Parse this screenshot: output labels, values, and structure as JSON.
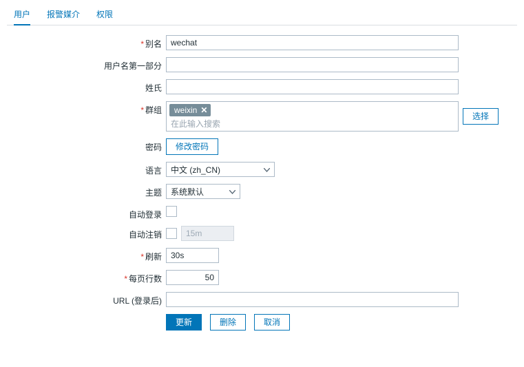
{
  "tabs": [
    "用户",
    "报警媒介",
    "权限"
  ],
  "active_tab": 0,
  "labels": {
    "alias": "别名",
    "first": "用户名第一部分",
    "last": "姓氏",
    "group": "群组",
    "pwd": "密码",
    "lang": "语言",
    "theme": "主题",
    "autologin": "自动登录",
    "autologout": "自动注销",
    "refresh": "刷新",
    "rows": "每页行数",
    "url": "URL (登录后)"
  },
  "values": {
    "alias": "wechat",
    "first": "",
    "last": "",
    "group_tag": "weixin",
    "group_search_ph": "在此输入搜索",
    "lang": "中文 (zh_CN)",
    "theme": "系统默认",
    "autologout_value": "15m",
    "refresh": "30s",
    "rows": "50",
    "url": ""
  },
  "buttons": {
    "choose": "选择",
    "change_pwd": "修改密码",
    "update": "更新",
    "delete": "删除",
    "cancel": "取消"
  }
}
